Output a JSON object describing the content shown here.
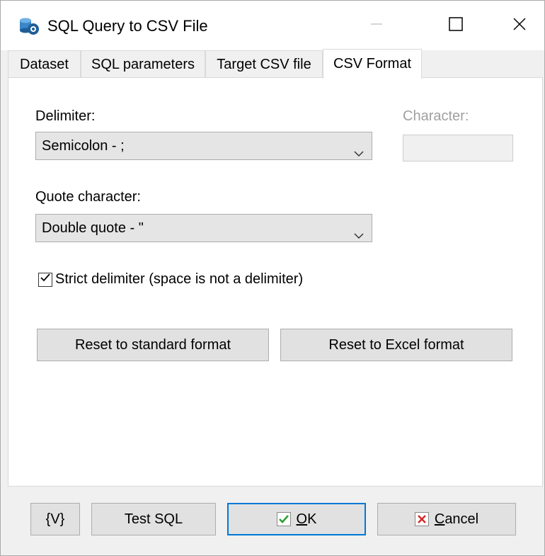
{
  "window": {
    "title": "SQL Query to CSV File"
  },
  "tabs": [
    {
      "label": "Dataset",
      "active": false
    },
    {
      "label": "SQL parameters",
      "active": false
    },
    {
      "label": "Target CSV file",
      "active": false
    },
    {
      "label": "CSV Format",
      "active": true
    }
  ],
  "form": {
    "delimiter_label": "Delimiter:",
    "delimiter_value": "Semicolon - ;",
    "character_label": "Character:",
    "quote_label": "Quote character:",
    "quote_value": "Double quote - \"",
    "strict_label": "Strict delimiter (space is not a delimiter)",
    "strict_checked": true,
    "reset_standard_label": "Reset to standard format",
    "reset_excel_label": "Reset to Excel format"
  },
  "footer": {
    "variables_label": "{V}",
    "test_sql_label": "Test SQL",
    "ok_label_underlined": "O",
    "ok_label_rest": "K",
    "cancel_label_underlined": "C",
    "cancel_label_rest": "ancel"
  },
  "colors": {
    "focus_border": "#0078d7",
    "ok_check": "#2e9e2e",
    "cancel_x": "#d42a2a"
  },
  "icons": {
    "app": "database-gear-icon",
    "minimize": "minimize-icon",
    "maximize": "maximize-icon",
    "close": "close-icon",
    "combo_arrow": "chevron-down-icon",
    "checkmark": "checkmark-icon",
    "ok": "ok-check-icon",
    "cancel": "cancel-x-icon"
  }
}
